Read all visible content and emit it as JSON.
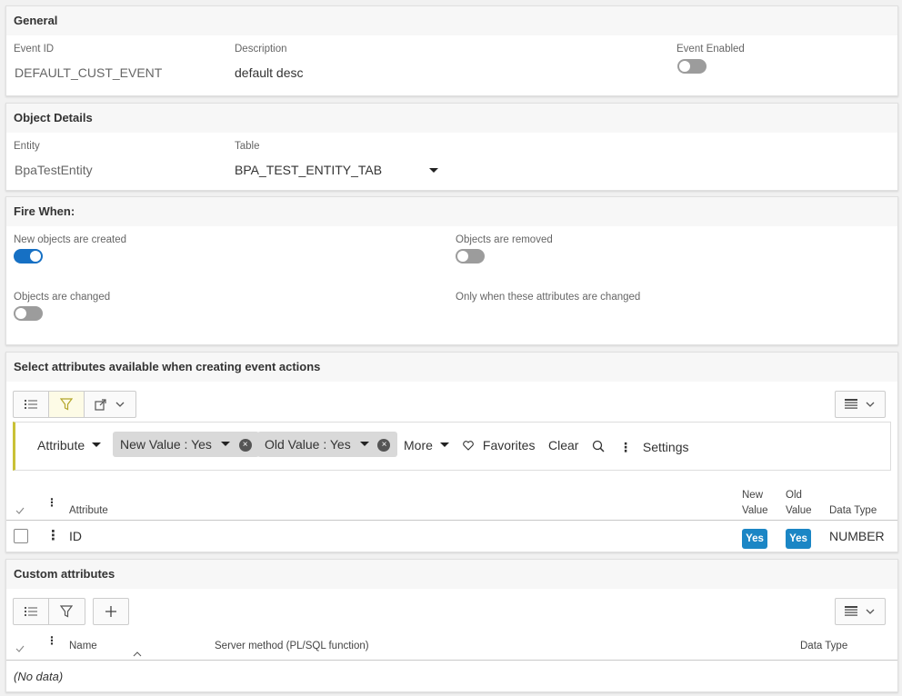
{
  "general": {
    "title": "General",
    "event_id_label": "Event ID",
    "event_id_value": "DEFAULT_CUST_EVENT",
    "description_label": "Description",
    "description_value": "default desc",
    "event_enabled_label": "Event Enabled",
    "event_enabled": false
  },
  "object_details": {
    "title": "Object Details",
    "entity_label": "Entity",
    "entity_value": "BpaTestEntity",
    "table_label": "Table",
    "table_value": "BPA_TEST_ENTITY_TAB"
  },
  "fire_when": {
    "title": "Fire When:",
    "created_label": "New objects are created",
    "created": true,
    "removed_label": "Objects are removed",
    "removed": false,
    "changed_label": "Objects are changed",
    "changed": false,
    "only_when_label": "Only when these attributes are changed"
  },
  "attributes": {
    "title": "Select attributes available when creating event actions",
    "filters": {
      "attribute_label": "Attribute",
      "chip1": "New Value : Yes",
      "chip2": "Old Value : Yes",
      "more_label": "More",
      "favorites_label": "Favorites",
      "clear_label": "Clear",
      "settings_label": "Settings"
    },
    "columns": {
      "attribute": "Attribute",
      "new_value_1": "New",
      "new_value_2": "Value",
      "old_value_1": "Old",
      "old_value_2": "Value",
      "data_type": "Data Type"
    },
    "rows": [
      {
        "attribute": "ID",
        "new_value": "Yes",
        "old_value": "Yes",
        "data_type": "NUMBER"
      }
    ]
  },
  "custom": {
    "title": "Custom attributes",
    "columns": {
      "name": "Name",
      "server_method": "Server method (PL/SQL function)",
      "data_type": "Data Type"
    },
    "no_data": "(No data)"
  },
  "colors": {
    "accent": "#1670c4",
    "badge": "#1b86c5",
    "filter_border": "#c9c136"
  }
}
